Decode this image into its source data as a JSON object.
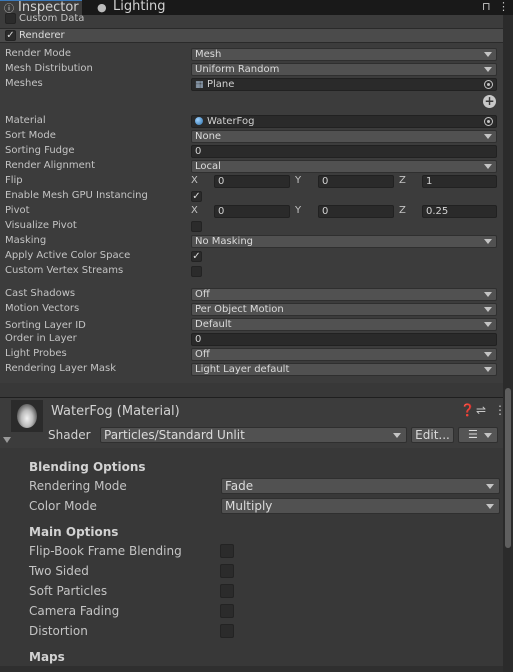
{
  "tabs": {
    "inspector": {
      "icon": "info-icon",
      "label": "Inspector"
    },
    "lighting": {
      "icon": "bulb-icon",
      "label": "Lighting"
    }
  },
  "module": {
    "custom_data_label": "Custom Data",
    "renderer_label": "Renderer",
    "rows": {
      "render_mode": {
        "label": "Render Mode",
        "value": "Mesh"
      },
      "mesh_distribution": {
        "label": "Mesh Distribution",
        "value": "Uniform Random"
      },
      "meshes": {
        "label": "Meshes",
        "value": "Plane"
      },
      "material": {
        "label": "Material",
        "value": "WaterFog"
      },
      "sort_mode": {
        "label": "Sort Mode",
        "value": "None"
      },
      "sorting_fudge": {
        "label": "Sorting Fudge",
        "value": "0"
      },
      "render_alignment": {
        "label": "Render Alignment",
        "value": "Local"
      },
      "flip": {
        "label": "Flip",
        "x": "0",
        "y": "0",
        "z": "1"
      },
      "gpu_instancing": {
        "label": "Enable Mesh GPU Instancing",
        "checked": true
      },
      "pivot": {
        "label": "Pivot",
        "x": "0",
        "y": "0",
        "z": "0.25"
      },
      "visualize_pivot": {
        "label": "Visualize Pivot",
        "checked": false
      },
      "masking": {
        "label": "Masking",
        "value": "No Masking"
      },
      "apply_color_space": {
        "label": "Apply Active Color Space",
        "checked": true
      },
      "custom_vertex_streams": {
        "label": "Custom Vertex Streams",
        "checked": false
      },
      "cast_shadows": {
        "label": "Cast Shadows",
        "value": "Off"
      },
      "motion_vectors": {
        "label": "Motion Vectors",
        "value": "Per Object Motion"
      },
      "sorting_layer": {
        "label": "Sorting Layer ID",
        "value": "Default"
      },
      "order_in_layer": {
        "label": "Order in Layer",
        "value": "0"
      },
      "light_probes": {
        "label": "Light Probes",
        "value": "Off"
      },
      "rendering_layer_mask": {
        "label": "Rendering Layer Mask",
        "value": "Light Layer default"
      }
    },
    "axis": {
      "x": "X",
      "y": "Y",
      "z": "Z"
    }
  },
  "material": {
    "title": "WaterFog (Material)",
    "shader_label": "Shader",
    "shader_value": "Particles/Standard Unlit",
    "edit_label": "Edit...",
    "blending_header": "Blending Options",
    "rendering_mode": {
      "label": "Rendering Mode",
      "value": "Fade"
    },
    "color_mode": {
      "label": "Color Mode",
      "value": "Multiply"
    },
    "main_header": "Main Options",
    "options": [
      {
        "label": "Flip-Book Frame Blending",
        "checked": false
      },
      {
        "label": "Two Sided",
        "checked": false
      },
      {
        "label": "Soft Particles",
        "checked": false
      },
      {
        "label": "Camera Fading",
        "checked": false
      },
      {
        "label": "Distortion",
        "checked": false
      }
    ],
    "maps_header": "Maps"
  },
  "glyphs": {
    "check": "✓",
    "lock": "🔒",
    "menu": "⋮",
    "help": "❓",
    "sliders": "⇌",
    "plus": "+",
    "list": "☰"
  }
}
